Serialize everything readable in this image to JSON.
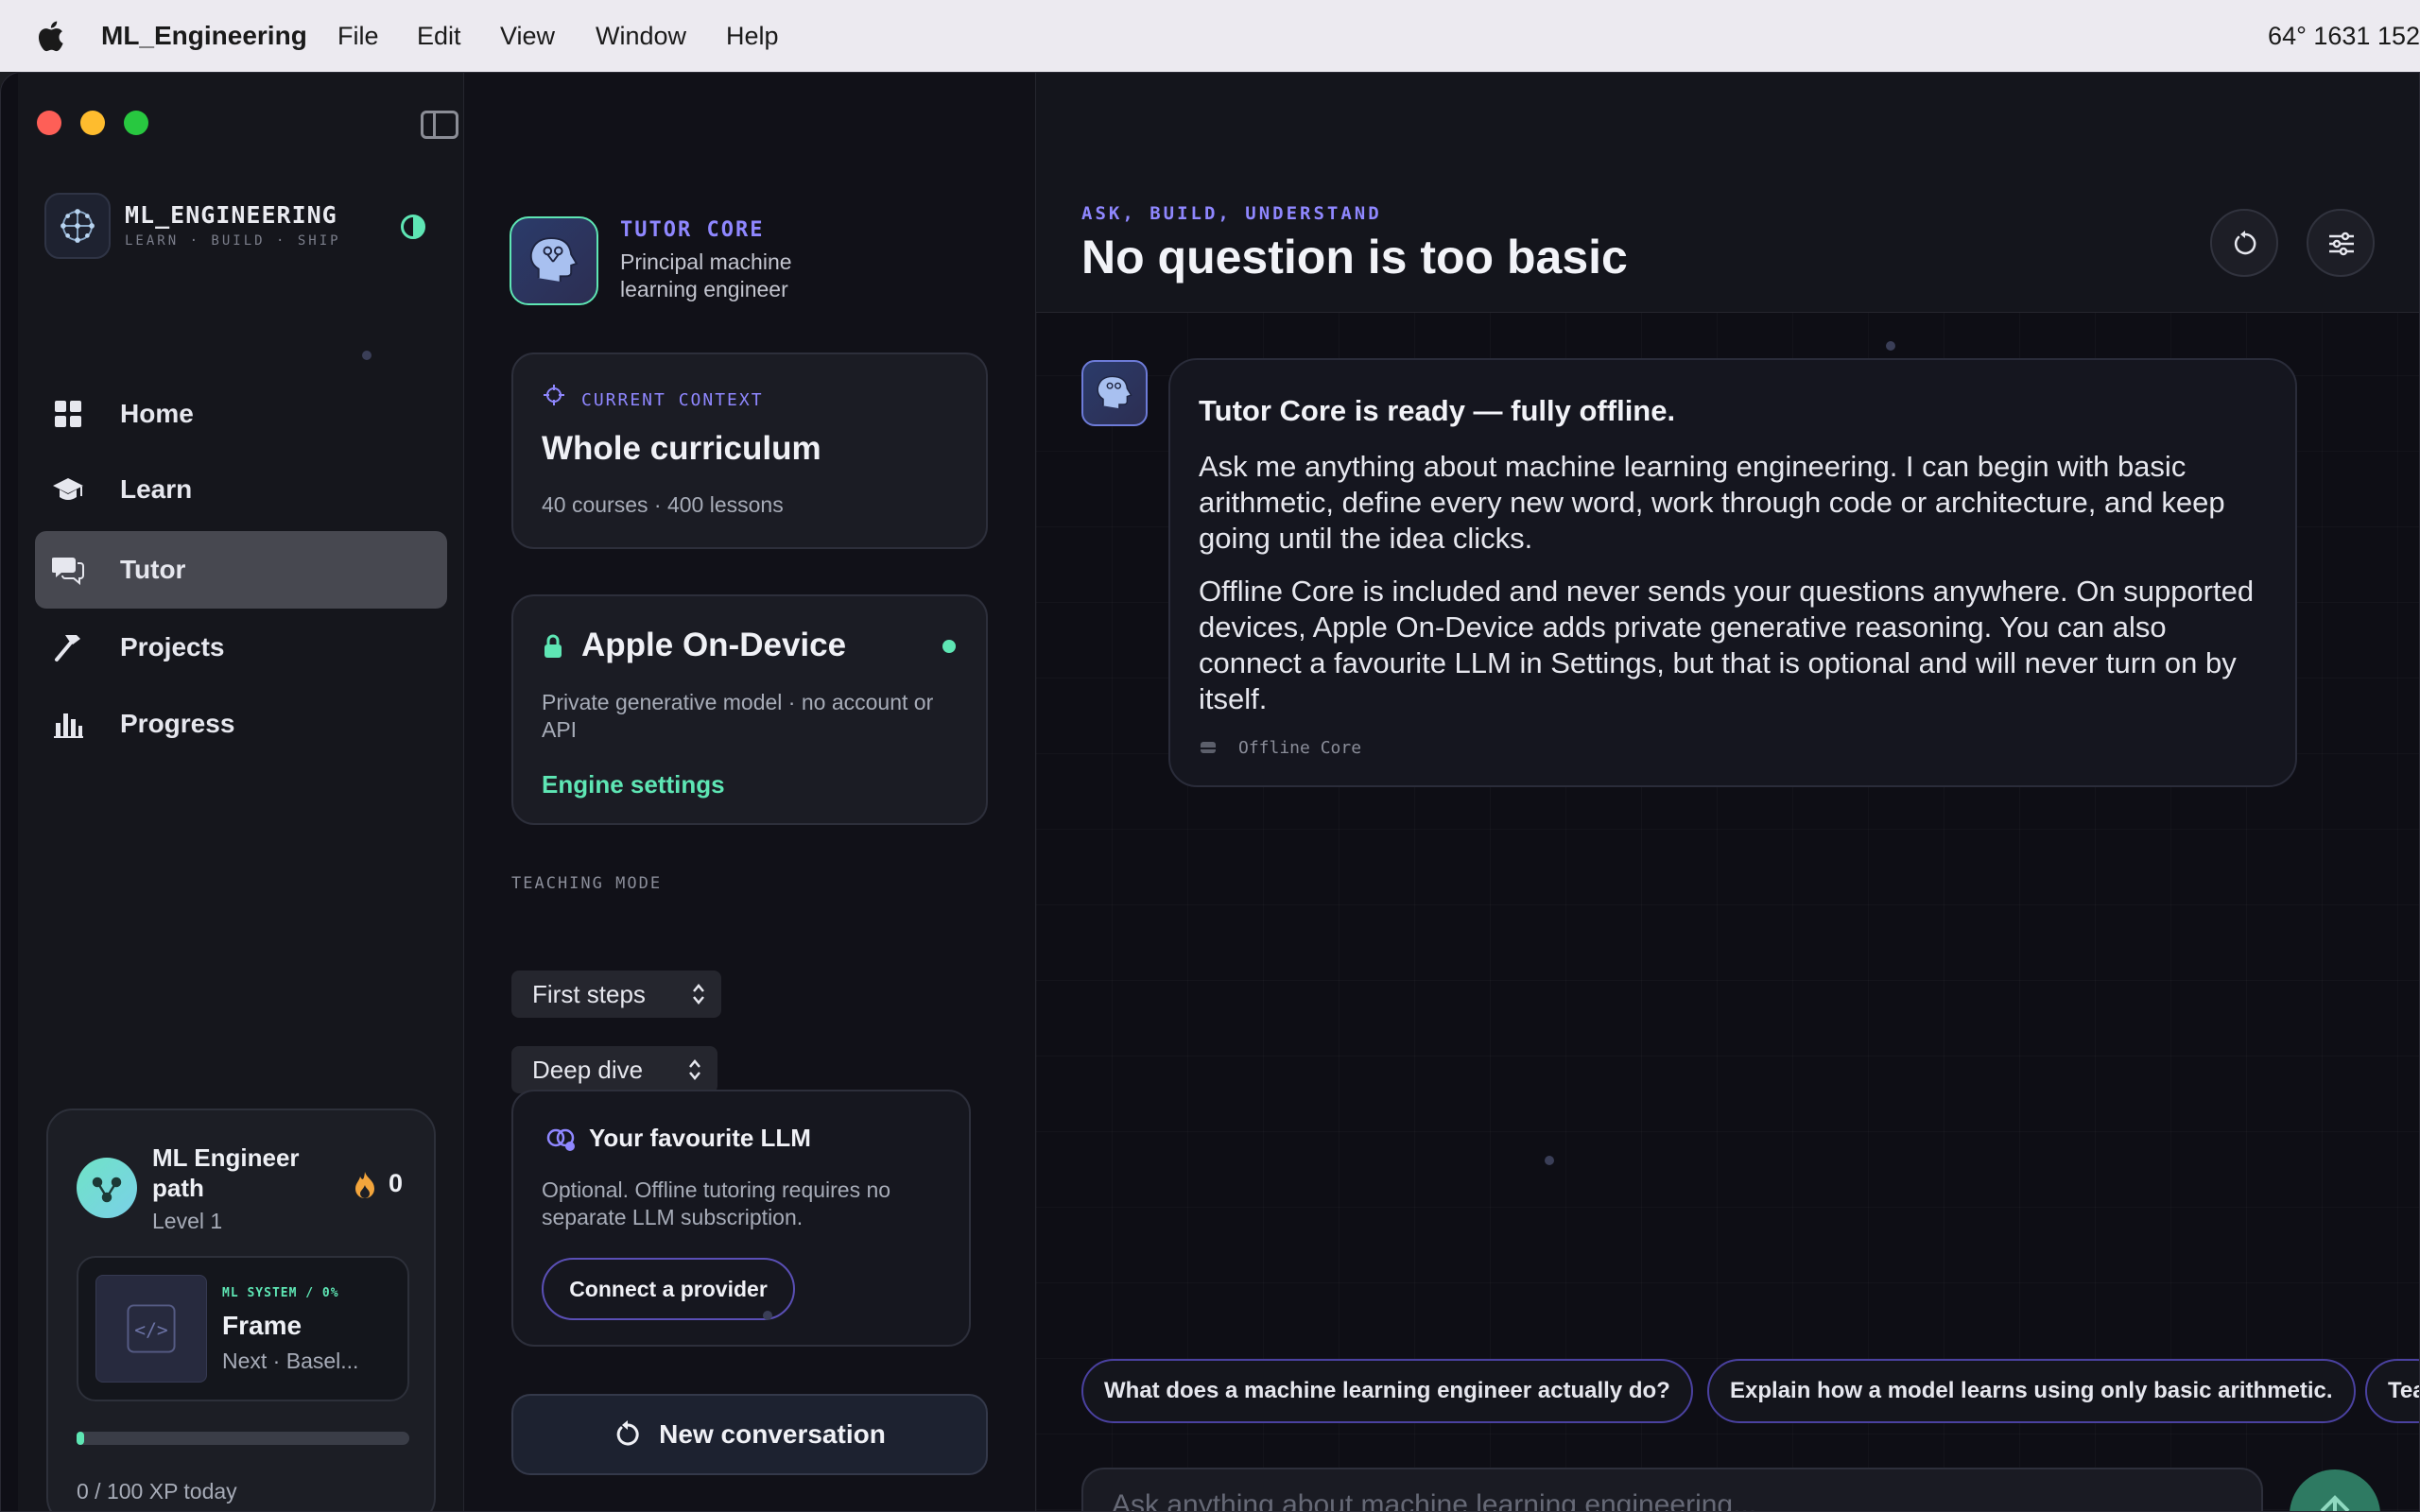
{
  "menubar": {
    "app_name": "ML_Engineering",
    "menus": [
      "File",
      "Edit",
      "View",
      "Window",
      "Help"
    ],
    "status": "64°   1631  152"
  },
  "sidebar": {
    "brand_title": "ML_ENGINEERING",
    "brand_subtitle": "LEARN · BUILD · SHIP",
    "nav": [
      {
        "label": "Home",
        "icon": "grid-icon"
      },
      {
        "label": "Learn",
        "icon": "graduation-cap-icon"
      },
      {
        "label": "Tutor",
        "icon": "chat-bubbles-icon",
        "active": true
      },
      {
        "label": "Projects",
        "icon": "hammer-icon"
      },
      {
        "label": "Progress",
        "icon": "bar-chart-icon"
      }
    ],
    "path_card": {
      "name": "ML Engineer path",
      "level": "Level 1",
      "streak": "0",
      "lesson_tag": "ML SYSTEM / 0%",
      "lesson_title": "Frame",
      "lesson_next": "Next · Basel...",
      "xp_progress": 0.0,
      "xp_label": "0 / 100 XP today"
    }
  },
  "middle": {
    "tutor_label": "TUTOR CORE",
    "tutor_role": "Principal machine learning engineer",
    "context": {
      "tag": "CURRENT CONTEXT",
      "title": "Whole curriculum",
      "subtitle": "40 courses · 400 lessons"
    },
    "engine": {
      "title": "Apple On-Device",
      "description": "Private generative model · no account or API",
      "link": "Engine settings",
      "status_color": "#5ee6b4"
    },
    "teaching_mode_label": "TEACHING MODE",
    "mode_select_1": "First steps",
    "mode_select_2": "Deep dive",
    "llm": {
      "title": "Your favourite LLM",
      "description": "Optional. Offline tutoring requires no separate LLM subscription.",
      "button": "Connect a provider"
    },
    "new_conversation": "New conversation"
  },
  "chat": {
    "eyebrow": "ASK, BUILD, UNDERSTAND",
    "headline": "No question is too basic",
    "message": {
      "title": "Tutor Core is ready — fully offline.",
      "paragraph_1": "Ask me anything about machine learning engineering. I can begin with basic arithmetic, define every new word, work through code or architecture, and keep going until the idea clicks.",
      "paragraph_2": "Offline Core is included and never sends your questions anywhere. On supported devices, Apple On-Device adds private generative reasoning. You can also connect a favourite LLM in Settings, but that is optional and will never turn on by itself.",
      "source": "Offline Core"
    },
    "suggestions": [
      "What does a machine learning engineer actually do?",
      "Explain how a model learns using only basic arithmetic.",
      "Tea"
    ],
    "composer_placeholder": "Ask anything about machine learning engineering..."
  },
  "colors": {
    "accent_purple": "#8f87ff",
    "accent_green": "#5ee6b4"
  }
}
